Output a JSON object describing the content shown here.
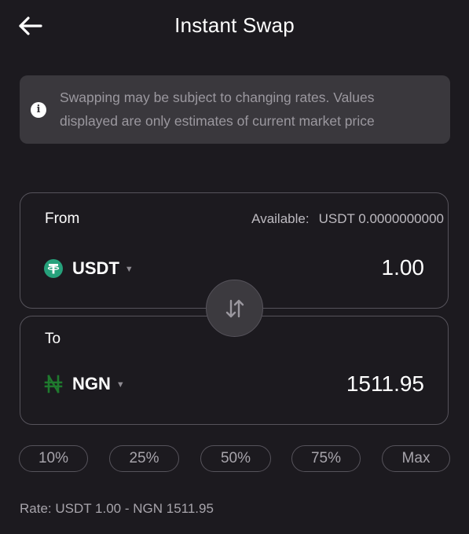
{
  "header": {
    "title": "Instant Swap",
    "back_icon": "arrow-left-icon"
  },
  "notice": {
    "icon": "info-icon",
    "icon_glyph": "i",
    "line1": "Swapping may be subject to changing rates. Values",
    "line2": "displayed are only estimates of current market price"
  },
  "from": {
    "label": "From",
    "available_label": "Available:",
    "available_value": "USDT 0.0000000000",
    "token": "USDT",
    "token_icon": "tether-icon",
    "token_color": "#26a17b",
    "amount": "1.00"
  },
  "to": {
    "label": "To",
    "token": "NGN",
    "token_icon": "naira-icon",
    "token_color": "#1f7a2e",
    "amount": "1511.95"
  },
  "swap_button": {
    "icon": "swap-arrows-icon"
  },
  "percent_options": [
    "10%",
    "25%",
    "50%",
    "75%",
    "Max"
  ],
  "rate": "Rate: USDT 1.00 - NGN 1511.95",
  "colors": {
    "background": "#1c1a1f",
    "notice_bg": "#3a383d",
    "border": "#56535b",
    "muted_text": "#a7a4ab"
  }
}
